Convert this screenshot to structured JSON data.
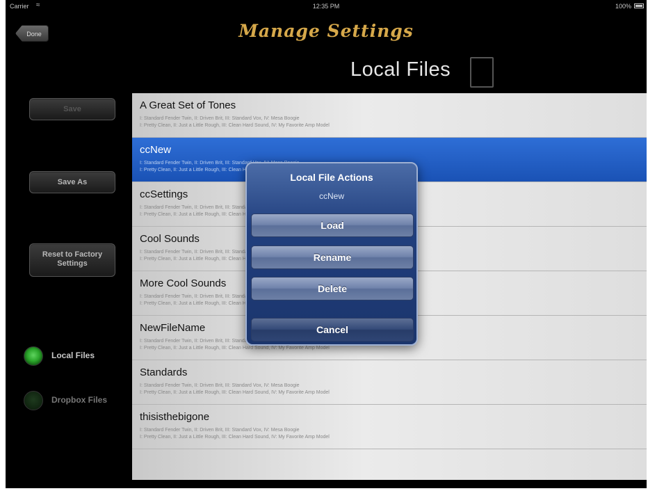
{
  "status_bar": {
    "carrier": "Carrier",
    "time": "12:35 PM",
    "battery": "100%"
  },
  "header": {
    "done_label": "Done",
    "title": "Manage Settings",
    "location": "Local Files"
  },
  "sidebar": {
    "save_label": "Save",
    "save_as_label": "Save As",
    "reset_label_line1": "Reset to Factory",
    "reset_label_line2": "Settings",
    "radios": [
      {
        "label": "Local Files",
        "selected": true
      },
      {
        "label": "Dropbox Files",
        "selected": false
      }
    ]
  },
  "files": [
    {
      "name": "A Great Set of Tones",
      "line1": "I: Standard Fender Twin, II: Driven Brit, III: Standard Vox, IV: Mesa Boogie",
      "line2": "I: Pretty Clean, II: Just a Little Rough, III: Clean Hard Sound, IV: My Favorite Amp Model"
    },
    {
      "name": "ccNew",
      "line1": "I: Standard Fender Twin, II: Driven Brit, III: Standard Vox, IV: Mesa Boogie",
      "line2": "I: Pretty Clean, II: Just a Little Rough, III: Clean Hard Sound, IV: My Favorite Amp Model",
      "selected": true
    },
    {
      "name": "ccSettings",
      "line1": "I: Standard Fender Twin, II: Driven Brit, III: Standard Vox, IV: Mesa Boogie",
      "line2": "I: Pretty Clean, II: Just a Little Rough, III: Clean Hard Sound, IV: My Favorite Amp Model"
    },
    {
      "name": "Cool Sounds",
      "line1": "I: Standard Fender Twin, II: Driven Brit, III: Standard Vox, IV: Mesa Boogie",
      "line2": "I: Pretty Clean, II: Just a Little Rough, III: Clean Hard Sound, IV: My Favorite Amp Model"
    },
    {
      "name": "More Cool Sounds",
      "line1": "I: Standard Fender Twin, II: Driven Brit, III: Standard Vox, IV: Mesa Boogie",
      "line2": "I: Pretty Clean, II: Just a Little Rough, III: Clean Hard Sound, IV: My Favorite Amp Model"
    },
    {
      "name": "NewFileName",
      "line1": "I: Standard Fender Twin, II: Driven Brit, III: Standard Vox, IV: Mesa Boogie",
      "line2": "I: Pretty Clean, II: Just a Little Rough, III: Clean Hard Sound, IV: My Favorite Amp Model"
    },
    {
      "name": "Standards",
      "line1": "I: Standard Fender Twin, II: Driven Brit, III: Standard Vox, IV: Mesa Boogie",
      "line2": "I: Pretty Clean, II: Just a Little Rough, III: Clean Hard Sound, IV: My Favorite Amp Model"
    },
    {
      "name": "thisisthebigone",
      "line1": "I: Standard Fender Twin, II: Driven Brit, III: Standard Vox, IV: Mesa Boogie",
      "line2": "I: Pretty Clean, II: Just a Little Rough, III: Clean Hard Sound, IV: My Favorite Amp Model"
    }
  ],
  "action_sheet": {
    "title": "Local File Actions",
    "subtitle": "ccNew",
    "load_label": "Load",
    "rename_label": "Rename",
    "delete_label": "Delete",
    "cancel_label": "Cancel"
  },
  "colors": {
    "title_gold": "#d6a84a",
    "selection_blue": "#2460c8",
    "radio_green": "#2aa52a"
  }
}
